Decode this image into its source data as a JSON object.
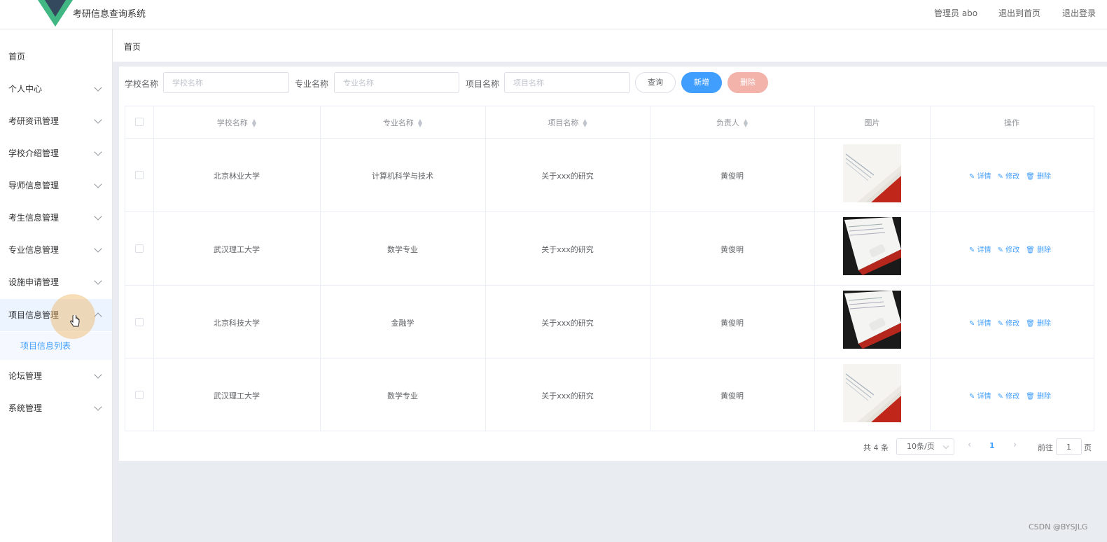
{
  "header": {
    "app_title": "考研信息查询系统",
    "admin_label": "管理员 abo",
    "back_home": "退出到首页",
    "logout": "退出登录",
    "logo_colors": [
      "#41b883",
      "#34495e"
    ]
  },
  "sidebar": {
    "items": [
      {
        "label": "首页",
        "expandable": false
      },
      {
        "label": "个人中心",
        "expandable": true
      },
      {
        "label": "考研资讯管理",
        "expandable": true
      },
      {
        "label": "学校介绍管理",
        "expandable": true
      },
      {
        "label": "导师信息管理",
        "expandable": true
      },
      {
        "label": "考生信息管理",
        "expandable": true
      },
      {
        "label": "专业信息管理",
        "expandable": true
      },
      {
        "label": "设施申请管理",
        "expandable": true
      },
      {
        "label": "项目信息管理",
        "expandable": true,
        "expanded": true,
        "active": true
      },
      {
        "label": "论坛管理",
        "expandable": true
      },
      {
        "label": "系统管理",
        "expandable": true
      }
    ],
    "sub_item": "项目信息列表"
  },
  "breadcrumb": "首页",
  "search": {
    "school_label": "学校名称",
    "school_placeholder": "学校名称",
    "major_label": "专业名称",
    "major_placeholder": "专业名称",
    "project_label": "项目名称",
    "project_placeholder": "项目名称",
    "query_button": "查询",
    "add_button": "新增",
    "delete_button": "删除"
  },
  "table": {
    "headers": [
      "学校名称",
      "专业名称",
      "项目名称",
      "负责人",
      "图片",
      "操作"
    ],
    "rows": [
      {
        "school": "北京林业大学",
        "major": "计算机科学与技术",
        "project": "关于xxx的研究",
        "owner": "黄俊明"
      },
      {
        "school": "武汉理工大学",
        "major": "数学专业",
        "project": "关于xxx的研究",
        "owner": "黄俊明"
      },
      {
        "school": "北京科技大学",
        "major": "金融学",
        "project": "关于xxx的研究",
        "owner": "黄俊明"
      },
      {
        "school": "武汉理工大学",
        "major": "数学专业",
        "project": "关于xxx的研究",
        "owner": "黄俊明"
      }
    ],
    "ops": {
      "detail": "详情",
      "edit": "修改",
      "delete": "删除"
    }
  },
  "pagination": {
    "total": "共 4 条",
    "page_size": "10条/页",
    "current_page": "1",
    "goto_label": "前往",
    "goto_value": "1",
    "page_suffix": "页"
  },
  "watermark": "CSDN @BYSJLG"
}
